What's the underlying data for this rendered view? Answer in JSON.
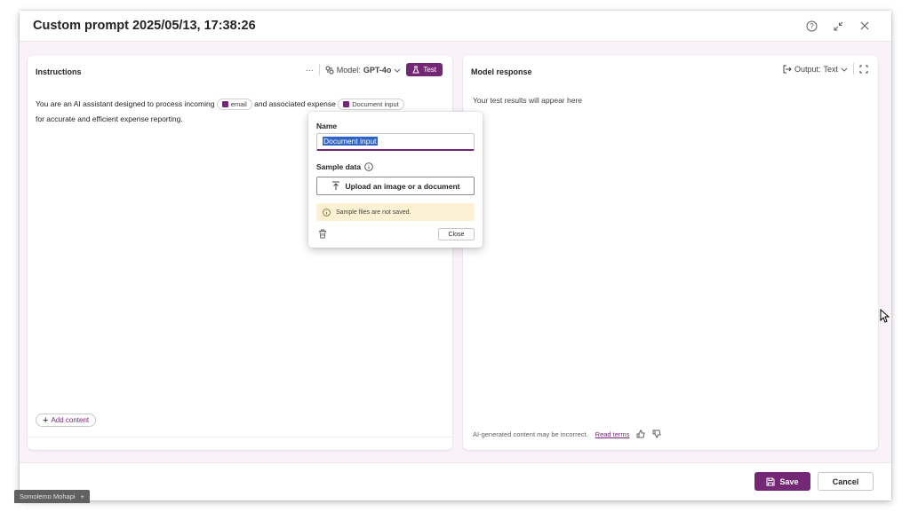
{
  "dialog": {
    "title": "Custom prompt 2025/05/13, 17:38:26",
    "header_icons": [
      "help-icon",
      "minimize-icon",
      "close-icon"
    ]
  },
  "instructions": {
    "title": "Instructions",
    "more": "···",
    "model_label": "Model:",
    "model_value": "GPT-4o",
    "test_label": "Test",
    "text_part1": "You are an AI assistant designed to process incoming",
    "chip_email": "email",
    "text_part2": "and associated expense",
    "chip_document": "Document input",
    "text_part3": "for accurate and efficient expense reporting.",
    "add_content": "Add content"
  },
  "response": {
    "title": "Model response",
    "output_label": "Output:",
    "output_value": "Text",
    "placeholder": "Your test results will appear here",
    "disclaimer": "AI-generated content may be incorrect.",
    "read_terms": "Read terms"
  },
  "popup": {
    "name_label": "Name",
    "name_value": "Document input",
    "sample_label": "Sample data",
    "upload_label": "Upload an image or a document",
    "warning": "Sample files are not saved.",
    "close_label": "Close"
  },
  "footer": {
    "save_label": "Save",
    "cancel_label": "Cancel"
  },
  "taskbar": {
    "user": "Somolemo Mohapi",
    "plus": "+"
  },
  "colors": {
    "accent": "#742774",
    "warning_bg": "#fcf1d2",
    "dialog_bg": "#f9f2f8"
  }
}
